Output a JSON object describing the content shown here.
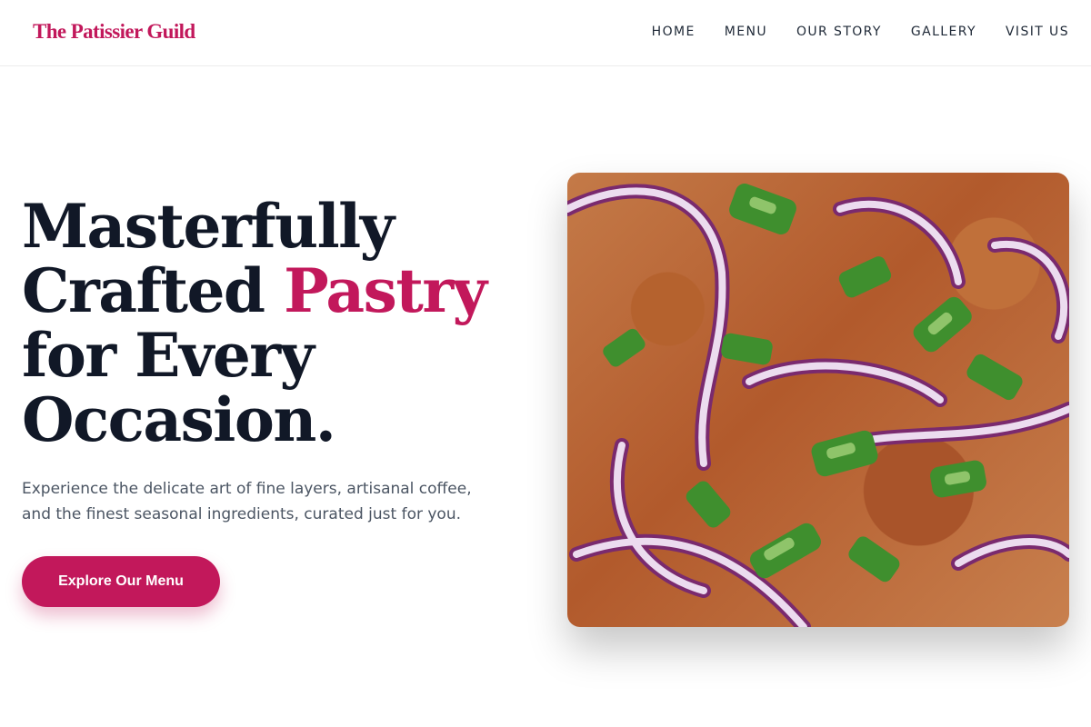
{
  "brand": {
    "name": "The Patissier Guild",
    "accent_color": "#c2185b"
  },
  "nav": {
    "items": [
      {
        "label": "HOME"
      },
      {
        "label": "MENU"
      },
      {
        "label": "OUR STORY"
      },
      {
        "label": "GALLERY"
      },
      {
        "label": "VISIT US"
      }
    ]
  },
  "hero": {
    "title_lines": [
      "Masterfully",
      "Crafted ",
      "Pastry",
      "for Every",
      "Occasion."
    ],
    "subtitle_lines": [
      "Experience the delicate art of fine layers, artisanal coffee,",
      "and the finest seasonal ingredients, curated just for you."
    ],
    "cta_label": "Explore Our Menu"
  },
  "image": {
    "subject": "close-up of food topped with sliced red onion and green onion"
  }
}
